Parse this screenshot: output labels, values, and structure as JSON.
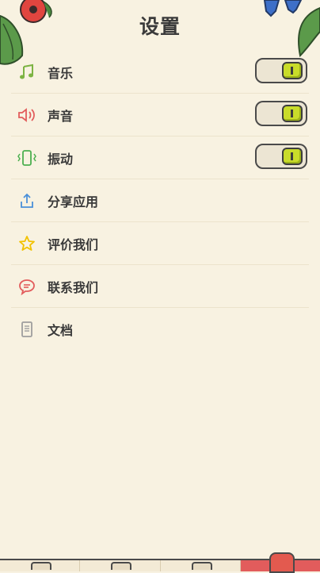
{
  "header": {
    "title": "设置"
  },
  "settings": {
    "items": [
      {
        "label": "音乐",
        "icon": "music-note-icon",
        "toggle": true,
        "on": true
      },
      {
        "label": "声音",
        "icon": "speaker-icon",
        "toggle": true,
        "on": true
      },
      {
        "label": "振动",
        "icon": "vibrate-icon",
        "toggle": true,
        "on": true
      },
      {
        "label": "分享应用",
        "icon": "share-icon",
        "toggle": false
      },
      {
        "label": "评价我们",
        "icon": "star-icon",
        "toggle": false
      },
      {
        "label": "联系我们",
        "icon": "chat-icon",
        "toggle": false
      },
      {
        "label": "文档",
        "icon": "document-icon",
        "toggle": false
      }
    ]
  },
  "colors": {
    "background": "#f8f2e1",
    "toggle_on": "#c9dc2a",
    "music_icon": "#7cb342",
    "speaker_icon": "#e25c5c",
    "vibrate_icon": "#4caf50",
    "share_icon": "#4a90d9",
    "star_icon": "#f2c200",
    "chat_icon": "#e25c5c",
    "document_icon": "#9e9e9e"
  },
  "tabbar": {
    "tabs": [
      {
        "icon": "tab-1-icon"
      },
      {
        "icon": "tab-2-icon"
      },
      {
        "icon": "tab-3-icon"
      },
      {
        "icon": "settings-tab-icon",
        "active": true
      }
    ]
  }
}
